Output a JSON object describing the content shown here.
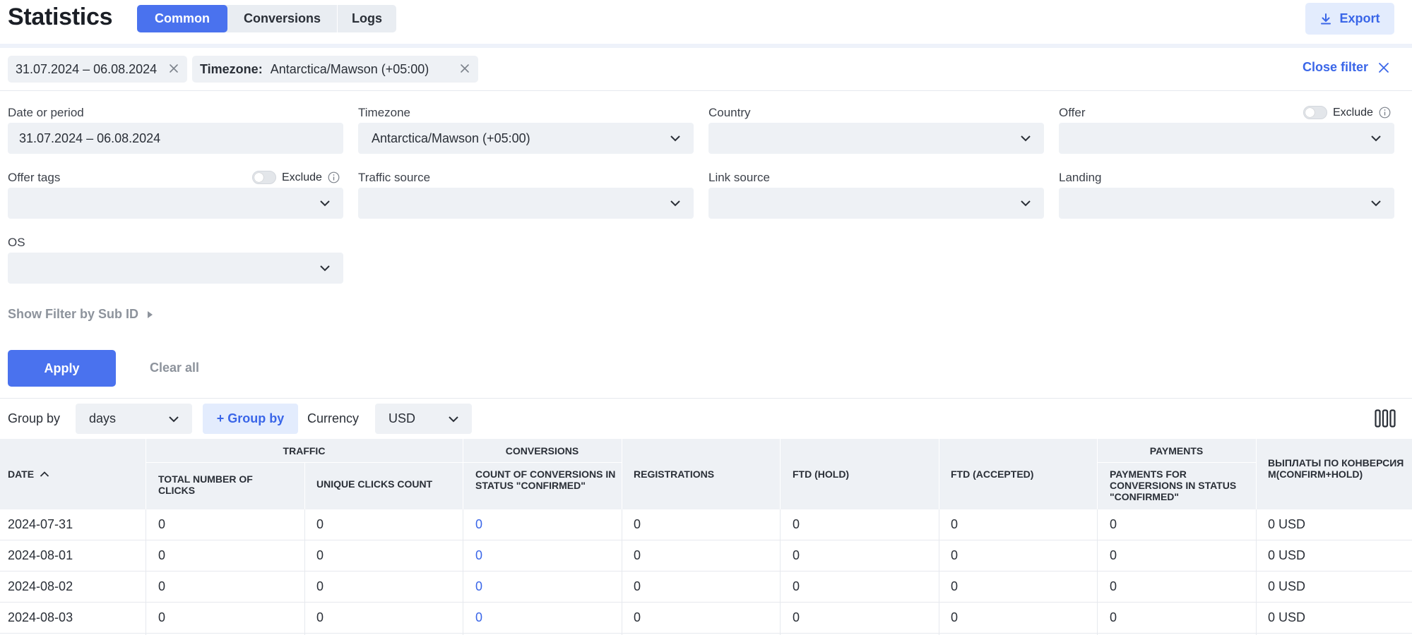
{
  "header": {
    "title": "Statistics",
    "tabs": [
      {
        "label": "Common",
        "active": true
      },
      {
        "label": "Conversions",
        "active": false
      },
      {
        "label": "Logs",
        "active": false
      }
    ],
    "export_label": "Export"
  },
  "chips": {
    "date_value": "31.07.2024 – 06.08.2024",
    "timezone_key": "Timezone:",
    "timezone_value": "Antarctica/Mawson (+05:00)",
    "close_filter_label": "Close filter"
  },
  "filters": {
    "date": {
      "label": "Date or period",
      "value": "31.07.2024 – 06.08.2024"
    },
    "timezone": {
      "label": "Timezone",
      "value": "Antarctica/Mawson (+05:00)"
    },
    "country": {
      "label": "Country",
      "value": ""
    },
    "offer": {
      "label": "Offer",
      "value": "",
      "exclude_label": "Exclude"
    },
    "offer_tags": {
      "label": "Offer tags",
      "value": "",
      "exclude_label": "Exclude"
    },
    "traffic_source": {
      "label": "Traffic source",
      "value": ""
    },
    "link_source": {
      "label": "Link source",
      "value": ""
    },
    "landing": {
      "label": "Landing",
      "value": ""
    },
    "os": {
      "label": "OS",
      "value": ""
    },
    "subid_link": "Show Filter by Sub ID",
    "apply_label": "Apply",
    "clear_label": "Clear all"
  },
  "grouping": {
    "group_by_label": "Group by",
    "group_by_value": "days",
    "add_group_label": "+ Group by",
    "currency_label": "Currency",
    "currency_value": "USD"
  },
  "table": {
    "groups": {
      "traffic": "TRAFFIC",
      "conversions": "CONVERSIONS",
      "payments": "PAYMENTS"
    },
    "columns": {
      "date": "DATE",
      "total_clicks": "TOTAL NUMBER OF CLICKS",
      "unique_clicks": "UNIQUE CLICKS COUNT",
      "conv_confirmed": "COUNT OF CONVERSIONS IN STATUS \"CONFIRMED\"",
      "registrations": "REGISTRATIONS",
      "ftd_hold": "FTD (HOLD)",
      "ftd_accepted": "FTD (ACCEPTED)",
      "payments_confirmed": "PAYMENTS FOR CONVERSIONS IN STATUS \"CONFIRMED\"",
      "payouts": "ВЫПЛАТЫ ПО КОНВЕРСИЯМ(CONFIRM+HOLD)"
    },
    "rows": [
      {
        "date": "2024-07-31",
        "total_clicks": "0",
        "unique_clicks": "0",
        "conv": "0",
        "registrations": "0",
        "ftd_hold": "0",
        "ftd_accepted": "0",
        "payments": "0",
        "payouts": "0 USD"
      },
      {
        "date": "2024-08-01",
        "total_clicks": "0",
        "unique_clicks": "0",
        "conv": "0",
        "registrations": "0",
        "ftd_hold": "0",
        "ftd_accepted": "0",
        "payments": "0",
        "payouts": "0 USD"
      },
      {
        "date": "2024-08-02",
        "total_clicks": "0",
        "unique_clicks": "0",
        "conv": "0",
        "registrations": "0",
        "ftd_hold": "0",
        "ftd_accepted": "0",
        "payments": "0",
        "payouts": "0 USD"
      },
      {
        "date": "2024-08-03",
        "total_clicks": "0",
        "unique_clicks": "0",
        "conv": "0",
        "registrations": "0",
        "ftd_hold": "0",
        "ftd_accepted": "0",
        "payments": "0",
        "payouts": "0 USD"
      }
    ]
  },
  "colors": {
    "accent": "#4a72ee",
    "accent_text": "#3a66e8",
    "accent_light": "#e3ecfd",
    "field_bg": "#eef1f5"
  }
}
